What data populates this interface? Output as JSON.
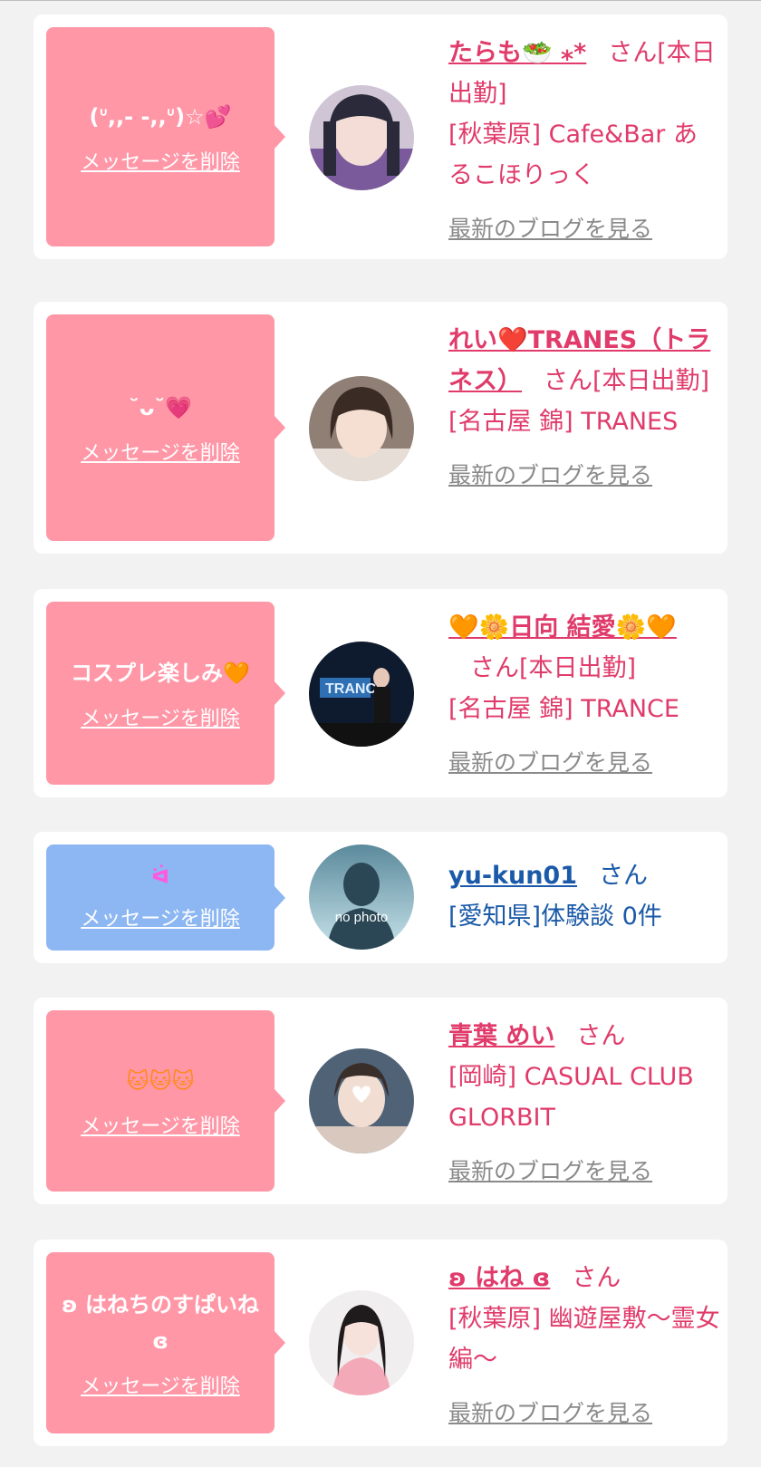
{
  "delete_label": "メッセージを削除",
  "blog_label": "最新のブログを見る",
  "honorific": "さん",
  "cards": [
    {
      "message": "(ᐡ,,- -,,ᐡ)☆💕",
      "name": "たらも🥗 ⁎*",
      "status": "[本日出勤]",
      "shop": "[秋葉原] Cafe&Bar あるこほりっく"
    },
    {
      "message": "˘ᴗ˘💗",
      "name": "れい❤️TRANES（トラネス）",
      "status": "[本日出勤]",
      "shop": "[名古屋 錦] TRANES"
    },
    {
      "message": "コスプレ楽しみ🧡",
      "name": "🧡🌼日向 結愛🌼🧡",
      "status": "[本日出勤]",
      "shop": "[名古屋 錦] TRANCE"
    },
    {
      "message": "ᐛ",
      "name": "yu-kun01",
      "shop": "[愛知県]体験談 0件",
      "avatar_text": "no photo"
    },
    {
      "message": "🐱🐱🐱",
      "name": "青葉 めい",
      "shop": "[岡崎] CASUAL CLUB GLORBIT"
    },
    {
      "message": "ʚ はねちのすぱいね ɞ",
      "name": "ʚ はね ɞ",
      "shop": "[秋葉原] 幽遊屋敷～霊女編～"
    }
  ],
  "colors": {
    "pink_bubble": "#ff97a7",
    "blue_bubble": "#8db7f3",
    "name_pink": "#e03b6a",
    "name_blue": "#1a5aa8",
    "blog_gray": "#8a8a8a"
  }
}
